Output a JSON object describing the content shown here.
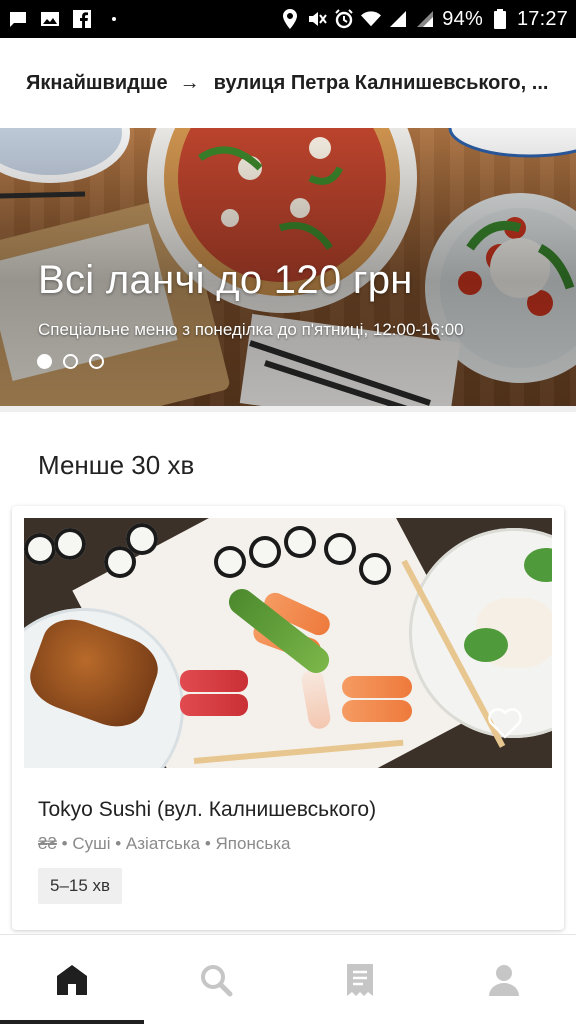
{
  "status_bar": {
    "battery": "94%",
    "time": "17:27",
    "icons": [
      "message-icon",
      "image-icon",
      "facebook-icon",
      "dot-icon",
      "location-icon",
      "mute-icon",
      "alarm-icon",
      "wifi-icon",
      "signal-icon",
      "signal-icon-2"
    ]
  },
  "address_bar": {
    "when": "Якнайшвидше",
    "arrow": "→",
    "address": "вулиця Петра Калнишевського, ..."
  },
  "hero": {
    "title": "Всі ланчі до 120 грн",
    "subtitle": "Спеціальне меню з понеділка до п'ятниці, 12:00-16:00",
    "slides_total": 3,
    "active_slide": 1
  },
  "section": {
    "title": "Менше 30 хв"
  },
  "restaurant": {
    "name": "Tokyo Sushi (вул. Калнишевського)",
    "price": "₴₴",
    "categories": "• Суші • Азіатська • Японська",
    "eta": "5–15 хв",
    "favorite_icon": "heart-outline-icon"
  },
  "bottom_nav": {
    "items": [
      {
        "name": "home",
        "icon": "home-icon",
        "active": true
      },
      {
        "name": "search",
        "icon": "search-icon",
        "active": false
      },
      {
        "name": "orders",
        "icon": "receipt-icon",
        "active": false
      },
      {
        "name": "account",
        "icon": "user-icon",
        "active": false
      }
    ]
  },
  "colors": {
    "accent": "#1f1f1f",
    "status_bar_bg": "#000000",
    "tag_bg": "#efefef"
  }
}
